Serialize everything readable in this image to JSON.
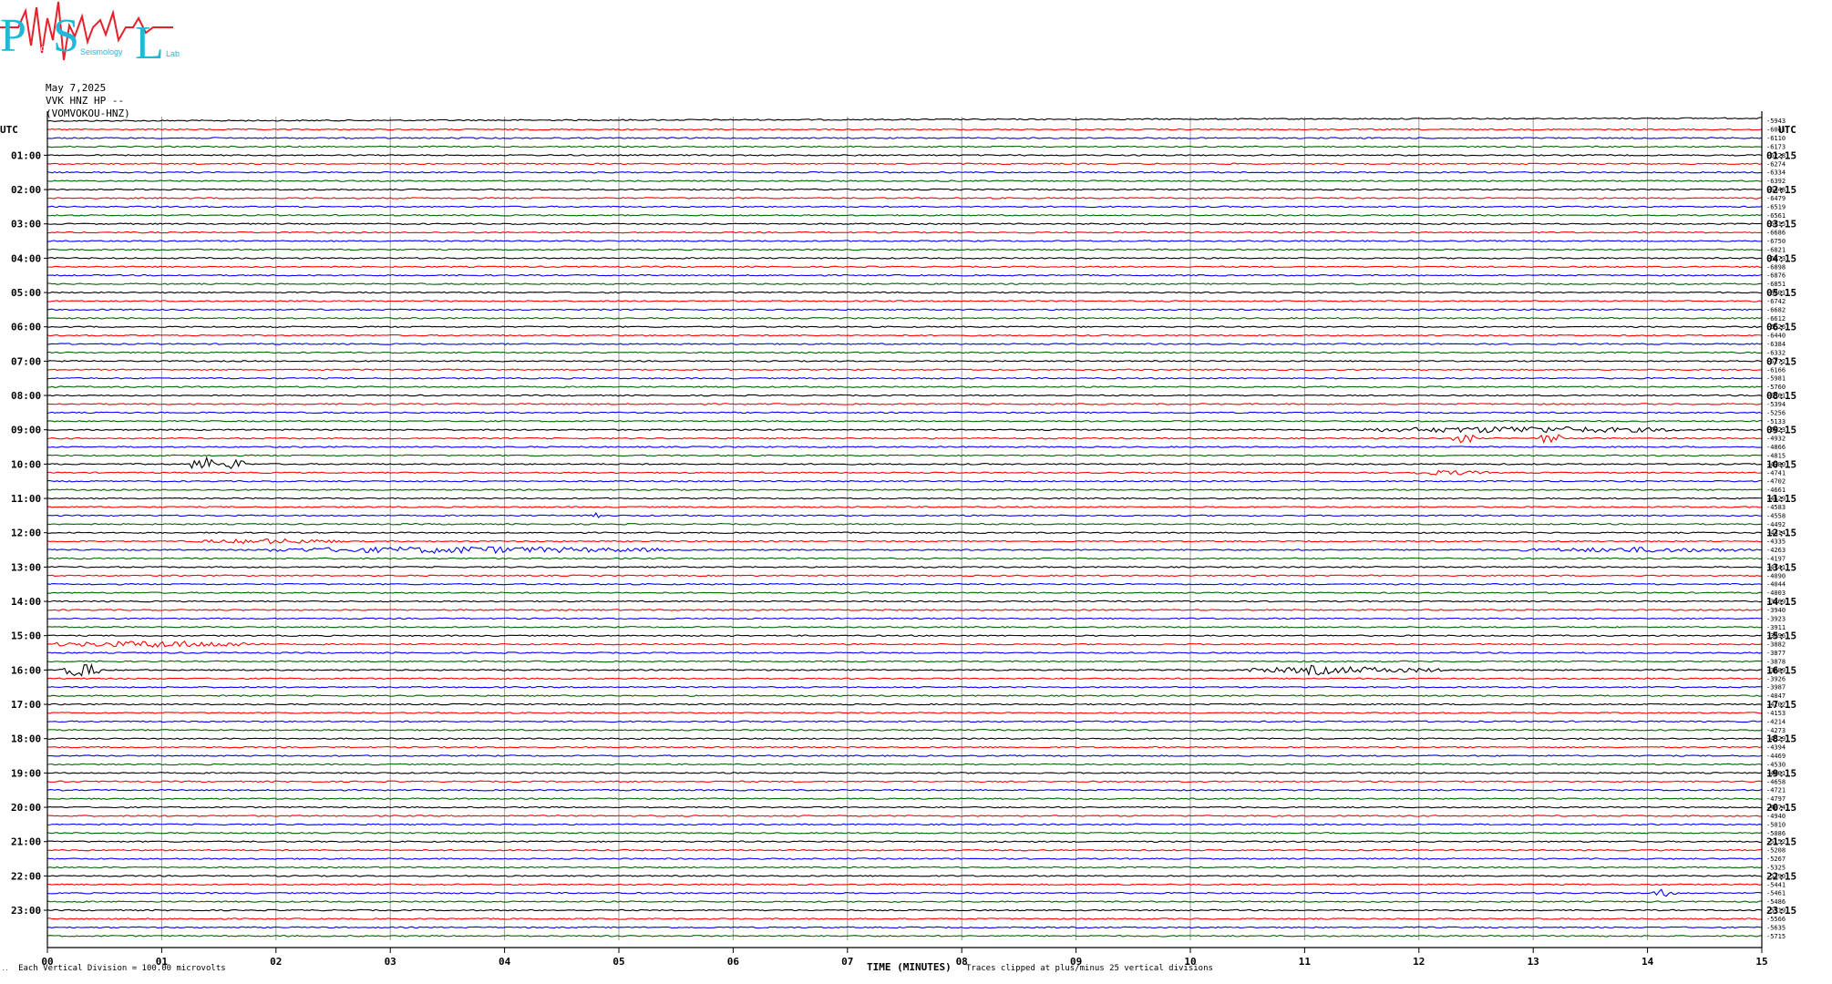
{
  "logo": {
    "letters": [
      "P",
      "S",
      "L"
    ],
    "words": [
      "Pomona",
      "Seismology",
      "Lab"
    ],
    "colors": {
      "letters": "#1fb8d8",
      "wave": "#e8202c"
    }
  },
  "header": {
    "date": "May 7,2025",
    "station": "VVK HNZ HP --",
    "channel": "(VOMVOKOU-HNZ)"
  },
  "chart_data": {
    "type": "line",
    "title": "",
    "xlabel": "TIME (MINUTES)",
    "xlim": [
      0,
      15
    ],
    "x_ticks": [
      "00",
      "01",
      "02",
      "03",
      "04",
      "05",
      "06",
      "07",
      "08",
      "09",
      "10",
      "11",
      "12",
      "13",
      "14",
      "15"
    ],
    "utc_header_left": "UTC",
    "utc_header_right": "UTC",
    "left_hour_labels": [
      "01:00",
      "02:00",
      "03:00",
      "04:00",
      "05:00",
      "06:00",
      "07:00",
      "08:00",
      "09:00",
      "10:00",
      "11:00",
      "12:00",
      "13:00",
      "14:00",
      "15:00",
      "16:00",
      "17:00",
      "18:00",
      "19:00",
      "20:00",
      "21:00",
      "22:00",
      "23:00"
    ],
    "right_hour_labels": [
      "01:15",
      "02:15",
      "03:15",
      "04:15",
      "05:15",
      "06:15",
      "07:15",
      "08:15",
      "09:15",
      "10:15",
      "11:15",
      "12:15",
      "13:15",
      "14:15",
      "15:15",
      "16:15",
      "17:15",
      "18:15",
      "19:15",
      "20:15",
      "21:15",
      "22:15",
      "23:15"
    ],
    "trace_count": 96,
    "minutes_per_trace": 15,
    "trace_colors": [
      "#000000",
      "#ff0000",
      "#0000ff",
      "#006400"
    ],
    "grid": "vertical lines every minute",
    "trace_counts": [
      "-5943",
      "-6041",
      "-6110",
      "-6173",
      "-6228",
      "-6274",
      "-6334",
      "-6392",
      "-6448",
      "-6479",
      "-6519",
      "-6561",
      "-6615",
      "-6686",
      "-6750",
      "-6821",
      "-6873",
      "-6898",
      "-6876",
      "-6851",
      "-6801",
      "-6742",
      "-6682",
      "-6612",
      "-6526",
      "-6440",
      "-6384",
      "-6332",
      "-6272",
      "-6166",
      "-5981",
      "-5760",
      "-5561",
      "-5394",
      "-5256",
      "-5133",
      "-5023",
      "-4932",
      "-4866",
      "-4815",
      "-4780",
      "-4741",
      "-4702",
      "-4661",
      "-4629",
      "-4583",
      "-4558",
      "-4492",
      "-4414",
      "-4335",
      "-4263",
      "-4197",
      "-4141",
      "-4090",
      "-4044",
      "-4003",
      "-3969",
      "-3940",
      "-3923",
      "-3911",
      "-3896",
      "-3882",
      "-3877",
      "-3878",
      "-3889",
      "-3926",
      "-3987",
      "-4047",
      "-4102",
      "-4153",
      "-4214",
      "-4273",
      "-4329",
      "-4394",
      "-4469",
      "-4530",
      "-4601",
      "-4658",
      "-4721",
      "-4797",
      "-4874",
      "-4940",
      "-5010",
      "-5086",
      "-5152",
      "-5208",
      "-5267",
      "-5325",
      "-5390",
      "-5441",
      "-5461",
      "-5486",
      "-5519",
      "-5566",
      "-5635",
      "-5715"
    ],
    "events": [
      {
        "trace": 0,
        "start": 0.0,
        "end": 15.0,
        "amp": 3,
        "note": "drift"
      },
      {
        "trace": 36,
        "start": 11.5,
        "end": 14.3,
        "amp": 4
      },
      {
        "trace": 37,
        "start": 12.3,
        "end": 12.5,
        "amp": 6
      },
      {
        "trace": 37,
        "start": 13.05,
        "end": 13.25,
        "amp": 7
      },
      {
        "trace": 40,
        "start": 1.25,
        "end": 1.5,
        "amp": 9
      },
      {
        "trace": 40,
        "start": 1.55,
        "end": 1.75,
        "amp": 7
      },
      {
        "trace": 41,
        "start": 11.9,
        "end": 12.6,
        "amp": 3
      },
      {
        "trace": 46,
        "start": 4.75,
        "end": 4.85,
        "amp": 3
      },
      {
        "trace": 49,
        "start": 1.3,
        "end": 2.6,
        "amp": 3
      },
      {
        "trace": 50,
        "start": 1.9,
        "end": 5.4,
        "amp": 4
      },
      {
        "trace": 50,
        "start": 12.9,
        "end": 14.9,
        "amp": 3
      },
      {
        "trace": 61,
        "start": 0.05,
        "end": 1.9,
        "amp": 4
      },
      {
        "trace": 64,
        "start": 0.15,
        "end": 0.45,
        "amp": 9
      },
      {
        "trace": 64,
        "start": 10.4,
        "end": 12.2,
        "amp": 4
      },
      {
        "trace": 64,
        "start": 10.9,
        "end": 11.3,
        "amp": 6
      },
      {
        "trace": 90,
        "start": 14.05,
        "end": 14.25,
        "amp": 5
      }
    ]
  },
  "footer": {
    "left_note": "Each Vertical Division =  100.00 microvolts",
    "clip_note": "Traces clipped at plus/minus 25 vertical divisions"
  }
}
